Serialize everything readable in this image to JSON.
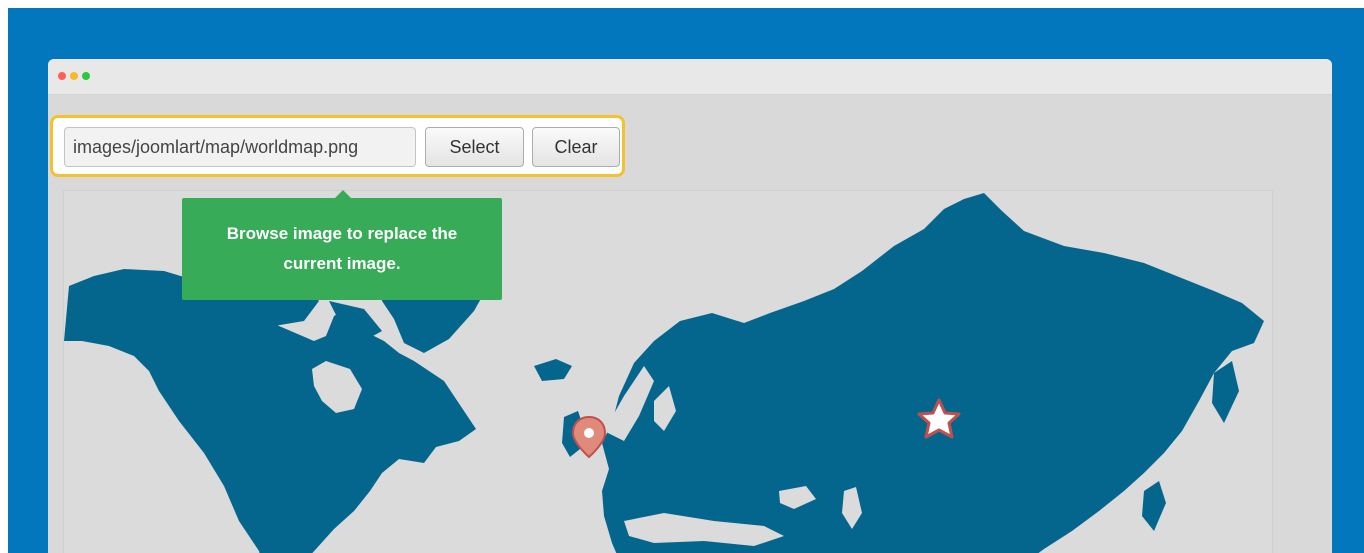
{
  "window": {
    "traffic_lights": {
      "close": "#ff5f57",
      "minimize": "#f7b928",
      "maximize": "#2ac940"
    }
  },
  "image_field": {
    "value": "images/joomlart/map/worldmap.png"
  },
  "buttons": {
    "select_label": "Select",
    "clear_label": "Clear"
  },
  "tooltip": {
    "text": "Browse image to replace the current image."
  },
  "map": {
    "land_color": "#05668d",
    "markers": [
      {
        "name": "location-pin-icon",
        "color": "#c0504d"
      },
      {
        "name": "star-marker-icon",
        "color": "#c0504d"
      }
    ]
  },
  "colors": {
    "background": "#0277bd",
    "highlight_border": "#f2c230",
    "tooltip": "#37ab58"
  }
}
